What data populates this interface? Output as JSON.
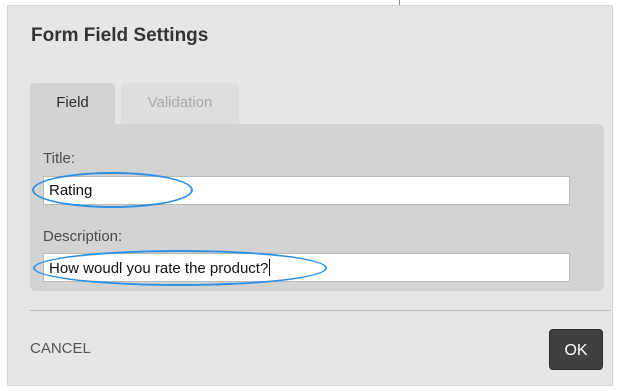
{
  "dialog": {
    "title": "Form Field Settings",
    "tabs": [
      {
        "label": "Field",
        "active": true
      },
      {
        "label": "Validation",
        "active": false
      }
    ],
    "fields": {
      "title": {
        "label": "Title:",
        "value": "Rating"
      },
      "description": {
        "label": "Description:",
        "value": "How woudl you rate the product?"
      }
    },
    "cancel_label": "CANCEL",
    "ok_label": "OK"
  },
  "colors": {
    "highlight": "#2b8fe6",
    "ok_button": "#404040",
    "panel": "#d3d3d3"
  }
}
